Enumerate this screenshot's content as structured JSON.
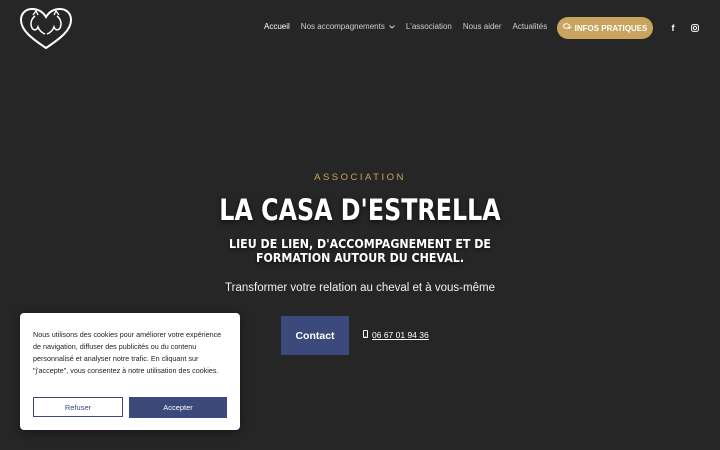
{
  "header": {
    "logo_icon": "horses-heart-logo-icon",
    "nav": [
      {
        "label": "Accueil"
      },
      {
        "label": "Nos accompagnements"
      },
      {
        "label": "L'association"
      },
      {
        "label": "Nous aider"
      },
      {
        "label": "Actualités"
      }
    ],
    "cta_label": "INFOS PRATIQUES",
    "cta_icon": "chat-bubbles-icon",
    "social": [
      "facebook-icon",
      "instagram-icon"
    ],
    "facebook_glyph": "f"
  },
  "hero": {
    "eyebrow": "ASSOCIATION",
    "title": "LA CASA D'ESTRELLA",
    "subtitle": "LIEU DE LIEN, D'ACCOMPAGNEMENT ET DE FORMATION AUTOUR DU CHEVAL.",
    "tagline": "Transformer votre relation au cheval et à vous-même",
    "contact_label": "Contact",
    "phone": "06 67 01 94 36",
    "phone_icon": "mobile-phone-icon"
  },
  "cookie": {
    "text": "Nous utilisons des cookies pour améliorer votre expérience de navigation, diffuser des publicités ou du contenu personnalisé et analyser notre trafic. En cliquant sur \"j'accepte\", vous consentez à notre utilisation des cookies.",
    "refuse_label": "Refuser",
    "accept_label": "Accepter"
  },
  "colors": {
    "background": "#262626",
    "accent_gold": "#c8a45e",
    "accent_blue": "#3b4a7a"
  }
}
